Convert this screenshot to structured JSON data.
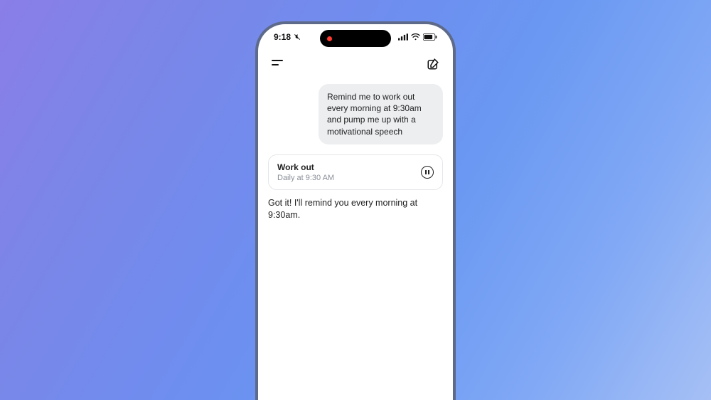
{
  "status": {
    "time": "9:18",
    "silent": true
  },
  "messages": {
    "user": "Remind me to work out every morning at 9:30am and pump me up with a motivational speech",
    "task": {
      "title": "Work out",
      "schedule": "Daily at 9:30 AM"
    },
    "assistant": "Got it! I'll remind you every morning at 9:30am."
  }
}
